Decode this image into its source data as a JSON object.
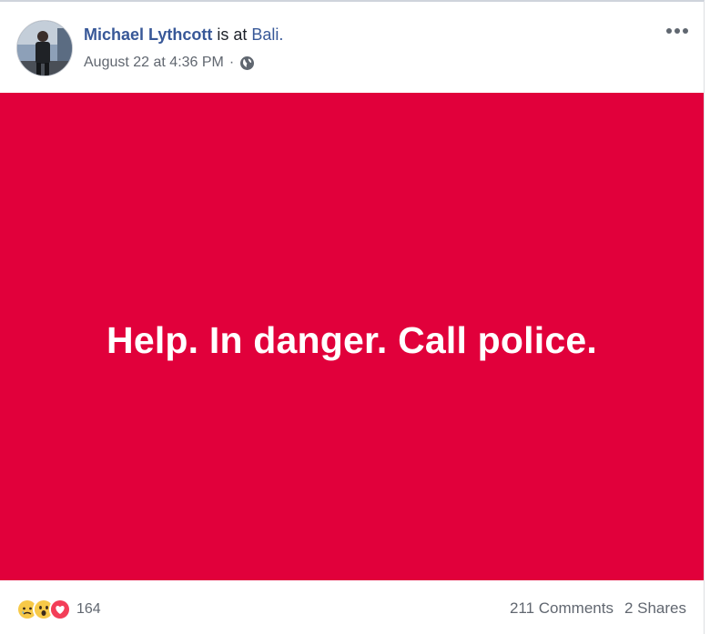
{
  "post": {
    "author": "Michael Lythcott",
    "action": "is at",
    "location": "Bali.",
    "timestamp": "August 22 at 4:36 PM",
    "separator": "·",
    "privacy_icon": "globe-icon",
    "more_icon": "more-options-icon",
    "text": "Help. In danger. Call police.",
    "background_color": "#e1003b"
  },
  "footer": {
    "reactions": [
      "sad-reaction-icon",
      "wow-reaction-icon",
      "love-reaction-icon"
    ],
    "reaction_count": "164",
    "comments": "211 Comments",
    "shares": "2 Shares"
  },
  "colors": {
    "link": "#385898",
    "secondary_text": "#616770",
    "love": "#f33e58",
    "emoji_yellow": "#f7c948"
  }
}
